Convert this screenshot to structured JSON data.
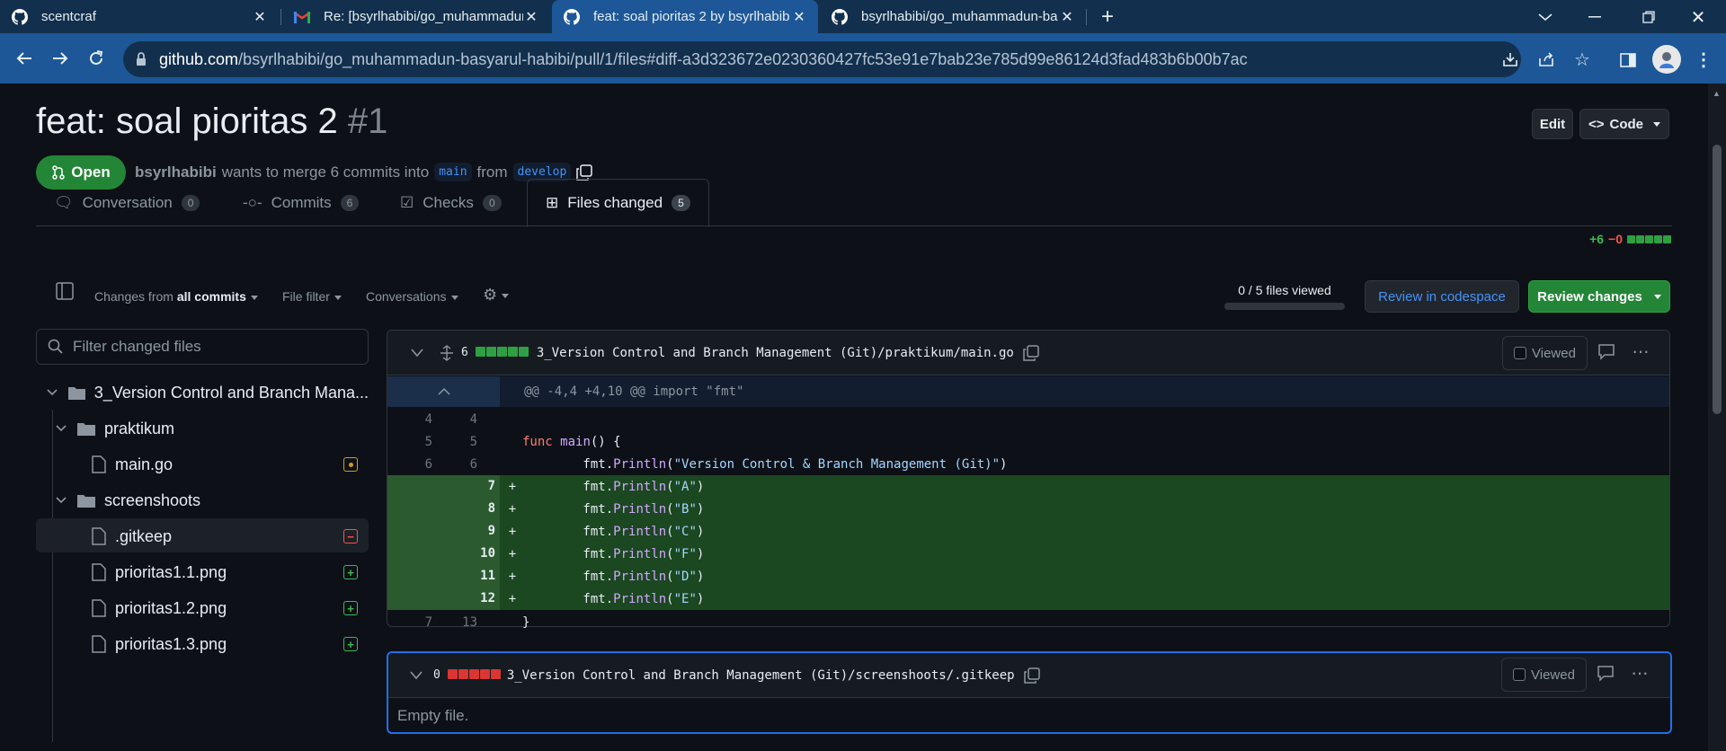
{
  "browser": {
    "tabs": [
      {
        "title": "scentcraf",
        "icon": "github-icon"
      },
      {
        "title": "Re: [bsyrlhabibi/go_muhammadun",
        "icon": "gmail-icon"
      },
      {
        "title": "feat: soal pioritas 2 by bsyrlhabib",
        "icon": "github-icon",
        "active": true
      },
      {
        "title": "bsyrlhabibi/go_muhammadun-ba",
        "icon": "github-icon"
      }
    ],
    "url_host": "github.com",
    "url_path": "/bsyrlhabibi/go_muhammadun-basyarul-habibi/pull/1/files#diff-a3d323672e0230360427fc53e91e7bab23e785d99e86124d3fad483b6b00b7ac"
  },
  "pr": {
    "title": "feat: soal pioritas 2",
    "number": "#1",
    "state": "Open",
    "author": "bsyrlhabibi",
    "merge_text": "wants to merge 6 commits into",
    "base": "main",
    "from_text": "from",
    "head": "develop",
    "edit_label": "Edit",
    "code_label": "Code"
  },
  "tabs": [
    {
      "label": "Conversation",
      "count": "0"
    },
    {
      "label": "Commits",
      "count": "6"
    },
    {
      "label": "Checks",
      "count": "0"
    },
    {
      "label": "Files changed",
      "count": "5",
      "active": true
    }
  ],
  "diffstat": {
    "added": "+6",
    "removed": "−0"
  },
  "filesbar": {
    "changes_from": "Changes from",
    "all_commits": "all commits",
    "file_filter": "File filter",
    "conversations": "Conversations",
    "viewed": "0 / 5 files viewed",
    "review_codespace": "Review in codespace",
    "review_changes": "Review changes"
  },
  "tree": {
    "filter_placeholder": "Filter changed files",
    "root": "3_Version Control and Branch Mana...",
    "folder1": "praktikum",
    "file1": "main.go",
    "folder2": "screenshoots",
    "files2": [
      ".gitkeep",
      "prioritas1.1.png",
      "prioritas1.2.png",
      "prioritas1.3.png"
    ]
  },
  "file1": {
    "count": "6",
    "path": "3_Version Control and Branch Management (Git)/praktikum/main.go",
    "viewed": "Viewed",
    "hunk": "@@ -4,4 +4,10 @@ import \"fmt\"",
    "lines": [
      {
        "old": "4",
        "new": "4",
        "sign": "",
        "code": ""
      },
      {
        "old": "5",
        "new": "5",
        "sign": "",
        "code": "func main() {"
      },
      {
        "old": "6",
        "new": "6",
        "sign": "",
        "code": "        fmt.Println(\"Version Control & Branch Management (Git)\")"
      },
      {
        "old": "",
        "new": "7",
        "sign": "+",
        "code": "        fmt.Println(\"A\")"
      },
      {
        "old": "",
        "new": "8",
        "sign": "+",
        "code": "        fmt.Println(\"B\")"
      },
      {
        "old": "",
        "new": "9",
        "sign": "+",
        "code": "        fmt.Println(\"C\")"
      },
      {
        "old": "",
        "new": "10",
        "sign": "+",
        "code": "        fmt.Println(\"F\")"
      },
      {
        "old": "",
        "new": "11",
        "sign": "+",
        "code": "        fmt.Println(\"D\")"
      },
      {
        "old": "",
        "new": "12",
        "sign": "+",
        "code": "        fmt.Println(\"E\")"
      },
      {
        "old": "7",
        "new": "13",
        "sign": "",
        "code": "}"
      }
    ]
  },
  "file2": {
    "count": "0",
    "path": "3_Version Control and Branch Management (Git)/screenshoots/.gitkeep",
    "viewed": "Viewed",
    "empty": "Empty file."
  },
  "colors": {
    "green": "#238636",
    "add_bg": "#1b4721",
    "add_gutter": "#2b5a2f",
    "removed": "#da3633",
    "accent": "#4493f8"
  }
}
